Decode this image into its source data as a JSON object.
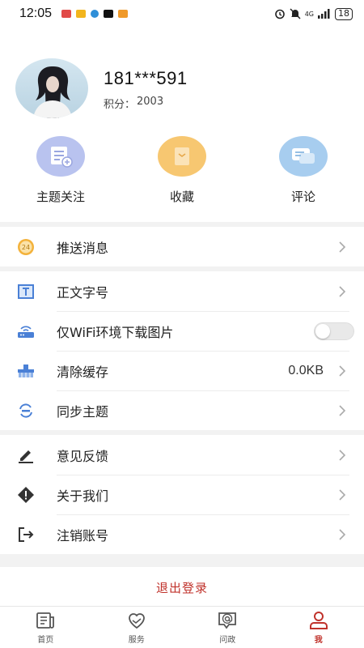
{
  "status_bar": {
    "time": "12:05",
    "network": "4G",
    "battery": "18"
  },
  "profile": {
    "username": "181***591",
    "points_label": "积分：",
    "points_value": "2003"
  },
  "shortcuts": [
    {
      "label": "主题关注",
      "icon": "topic-follow-icon",
      "color": "#b9c3ef"
    },
    {
      "label": "收藏",
      "icon": "favorite-icon",
      "color": "#f7c771"
    },
    {
      "label": "评论",
      "icon": "comment-icon",
      "color": "#a7cdef"
    }
  ],
  "groups": {
    "push": {
      "label": "推送消息",
      "icon_text": "24"
    },
    "settings": [
      {
        "label": "正文字号"
      },
      {
        "label": "仅WiFi环境下载图片",
        "toggle": false
      },
      {
        "label": "清除缓存",
        "value": "0.0KB"
      },
      {
        "label": "同步主题"
      }
    ],
    "about": [
      {
        "label": "意见反馈"
      },
      {
        "label": "关于我们"
      },
      {
        "label": "注销账号"
      }
    ]
  },
  "logout_label": "退出登录",
  "nav": [
    {
      "label": "首页",
      "active": false
    },
    {
      "label": "服务",
      "active": false
    },
    {
      "label": "问政",
      "active": false
    },
    {
      "label": "我",
      "active": true
    }
  ],
  "colors": {
    "accent": "#c0322b",
    "background": "#f2f2f2"
  }
}
